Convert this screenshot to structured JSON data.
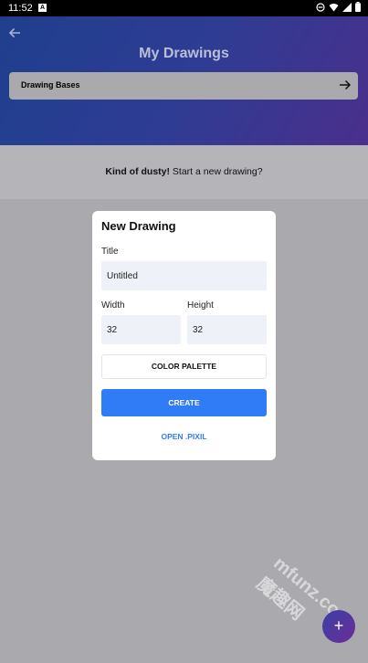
{
  "status_bar": {
    "time": "11:52",
    "notification": "A"
  },
  "header": {
    "title": "My Drawings",
    "drawing_bases_label": "Drawing Bases"
  },
  "empty_state": {
    "bold": "Kind of dusty!",
    "text": " Start a new drawing?"
  },
  "dialog": {
    "title": "New Drawing",
    "title_label": "Title",
    "title_value": "Untitled",
    "width_label": "Width",
    "width_value": "32",
    "height_label": "Height",
    "height_value": "32",
    "palette_button": "COLOR PALETTE",
    "create_button": "CREATE",
    "open_button": "OPEN .PIXIL"
  },
  "fab": {
    "icon": "+"
  },
  "watermark": "mfunz.com 魔趣网",
  "colors": {
    "accent": "#2f7cf6",
    "field_bg": "#eef1f7"
  }
}
